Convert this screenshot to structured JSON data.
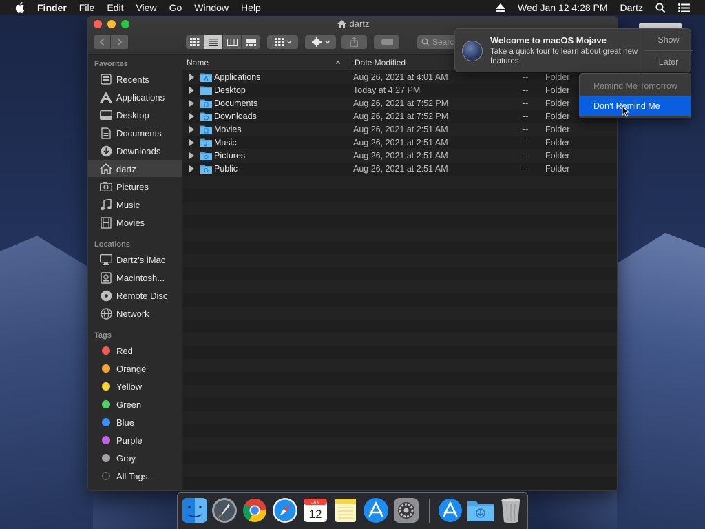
{
  "menubar": {
    "app": "Finder",
    "items": [
      "File",
      "Edit",
      "View",
      "Go",
      "Window",
      "Help"
    ],
    "clock": "Wed Jan 12  4:28 PM",
    "user": "Dartz"
  },
  "window": {
    "title": "dartz",
    "search_placeholder": "Search"
  },
  "sidebar": {
    "favorites_header": "Favorites",
    "favorites": [
      {
        "label": "Recents",
        "icon": "recents-icon"
      },
      {
        "label": "Applications",
        "icon": "applications-icon"
      },
      {
        "label": "Desktop",
        "icon": "desktop-icon"
      },
      {
        "label": "Documents",
        "icon": "documents-icon"
      },
      {
        "label": "Downloads",
        "icon": "downloads-icon"
      },
      {
        "label": "dartz",
        "icon": "home-icon",
        "selected": true
      },
      {
        "label": "Pictures",
        "icon": "pictures-icon"
      },
      {
        "label": "Music",
        "icon": "music-icon"
      },
      {
        "label": "Movies",
        "icon": "movies-icon"
      }
    ],
    "locations_header": "Locations",
    "locations": [
      {
        "label": "Dartz’s iMac",
        "icon": "computer-icon"
      },
      {
        "label": "Macintosh...",
        "icon": "hard-disk-icon"
      },
      {
        "label": "Remote Disc",
        "icon": "disc-icon"
      },
      {
        "label": "Network",
        "icon": "network-icon"
      }
    ],
    "tags_header": "Tags",
    "tags": [
      {
        "label": "Red",
        "color": "#f25a55"
      },
      {
        "label": "Orange",
        "color": "#f5a332"
      },
      {
        "label": "Yellow",
        "color": "#f7d530"
      },
      {
        "label": "Green",
        "color": "#4fd364"
      },
      {
        "label": "Blue",
        "color": "#3b8ff7"
      },
      {
        "label": "Purple",
        "color": "#c162e6"
      },
      {
        "label": "Gray",
        "color": "#a1a1a6"
      },
      {
        "label": "All Tags...",
        "color": "#4a4a4a"
      }
    ]
  },
  "list": {
    "columns": {
      "name": "Name",
      "date": "Date Modified"
    },
    "rows": [
      {
        "name": "Applications",
        "date": "Aug 26, 2021 at 4:01 AM",
        "size": "--",
        "kind": "Folder"
      },
      {
        "name": "Desktop",
        "date": "Today at 4:27 PM",
        "size": "--",
        "kind": "Folder"
      },
      {
        "name": "Documents",
        "date": "Aug 26, 2021 at 7:52 PM",
        "size": "--",
        "kind": "Folder"
      },
      {
        "name": "Downloads",
        "date": "Aug 26, 2021 at 7:52 PM",
        "size": "--",
        "kind": "Folder"
      },
      {
        "name": "Movies",
        "date": "Aug 26, 2021 at 2:51 AM",
        "size": "--",
        "kind": "Folder"
      },
      {
        "name": "Music",
        "date": "Aug 26, 2021 at 2:51 AM",
        "size": "--",
        "kind": "Folder"
      },
      {
        "name": "Pictures",
        "date": "Aug 26, 2021 at 2:51 AM",
        "size": "--",
        "kind": "Folder"
      },
      {
        "name": "Public",
        "date": "Aug 26, 2021 at 2:51 AM",
        "size": "--",
        "kind": "Folder"
      }
    ]
  },
  "notification": {
    "title": "Welcome to macOS Mojave",
    "body": "Take a quick tour to learn about great new features.",
    "show_label": "Show",
    "later_label": "Later",
    "menu": {
      "remind_tomorrow": "Remind Me Tomorrow",
      "dont_remind": "Don’t Remind Me"
    }
  },
  "dock": {
    "calendar_month": "JAN",
    "calendar_day": "12",
    "apps": [
      "finder-icon",
      "launchpad-icon",
      "chrome-icon",
      "safari-icon",
      "calendar-icon",
      "notes-icon",
      "app-store-icon",
      "system-preferences-icon",
      "app-store-downloads-icon",
      "downloads-folder-icon",
      "trash-icon"
    ]
  }
}
